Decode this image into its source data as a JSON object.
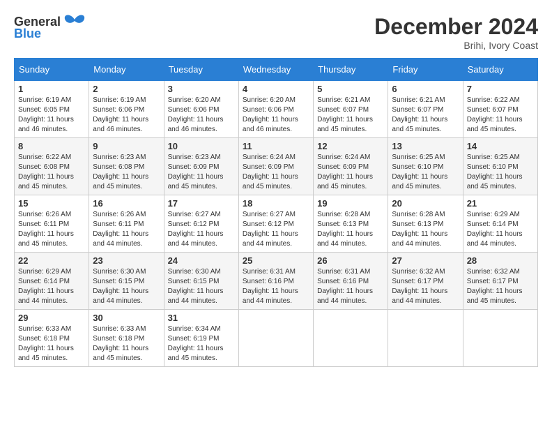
{
  "header": {
    "logo_general": "General",
    "logo_blue": "Blue",
    "month_title": "December 2024",
    "location": "Brihi, Ivory Coast"
  },
  "days_of_week": [
    "Sunday",
    "Monday",
    "Tuesday",
    "Wednesday",
    "Thursday",
    "Friday",
    "Saturday"
  ],
  "weeks": [
    [
      {
        "day": "1",
        "sunrise": "6:19 AM",
        "sunset": "6:05 PM",
        "daylight": "11 hours and 46 minutes."
      },
      {
        "day": "2",
        "sunrise": "6:19 AM",
        "sunset": "6:06 PM",
        "daylight": "11 hours and 46 minutes."
      },
      {
        "day": "3",
        "sunrise": "6:20 AM",
        "sunset": "6:06 PM",
        "daylight": "11 hours and 46 minutes."
      },
      {
        "day": "4",
        "sunrise": "6:20 AM",
        "sunset": "6:06 PM",
        "daylight": "11 hours and 46 minutes."
      },
      {
        "day": "5",
        "sunrise": "6:21 AM",
        "sunset": "6:07 PM",
        "daylight": "11 hours and 45 minutes."
      },
      {
        "day": "6",
        "sunrise": "6:21 AM",
        "sunset": "6:07 PM",
        "daylight": "11 hours and 45 minutes."
      },
      {
        "day": "7",
        "sunrise": "6:22 AM",
        "sunset": "6:07 PM",
        "daylight": "11 hours and 45 minutes."
      }
    ],
    [
      {
        "day": "8",
        "sunrise": "6:22 AM",
        "sunset": "6:08 PM",
        "daylight": "11 hours and 45 minutes."
      },
      {
        "day": "9",
        "sunrise": "6:23 AM",
        "sunset": "6:08 PM",
        "daylight": "11 hours and 45 minutes."
      },
      {
        "day": "10",
        "sunrise": "6:23 AM",
        "sunset": "6:09 PM",
        "daylight": "11 hours and 45 minutes."
      },
      {
        "day": "11",
        "sunrise": "6:24 AM",
        "sunset": "6:09 PM",
        "daylight": "11 hours and 45 minutes."
      },
      {
        "day": "12",
        "sunrise": "6:24 AM",
        "sunset": "6:09 PM",
        "daylight": "11 hours and 45 minutes."
      },
      {
        "day": "13",
        "sunrise": "6:25 AM",
        "sunset": "6:10 PM",
        "daylight": "11 hours and 45 minutes."
      },
      {
        "day": "14",
        "sunrise": "6:25 AM",
        "sunset": "6:10 PM",
        "daylight": "11 hours and 45 minutes."
      }
    ],
    [
      {
        "day": "15",
        "sunrise": "6:26 AM",
        "sunset": "6:11 PM",
        "daylight": "11 hours and 45 minutes."
      },
      {
        "day": "16",
        "sunrise": "6:26 AM",
        "sunset": "6:11 PM",
        "daylight": "11 hours and 44 minutes."
      },
      {
        "day": "17",
        "sunrise": "6:27 AM",
        "sunset": "6:12 PM",
        "daylight": "11 hours and 44 minutes."
      },
      {
        "day": "18",
        "sunrise": "6:27 AM",
        "sunset": "6:12 PM",
        "daylight": "11 hours and 44 minutes."
      },
      {
        "day": "19",
        "sunrise": "6:28 AM",
        "sunset": "6:13 PM",
        "daylight": "11 hours and 44 minutes."
      },
      {
        "day": "20",
        "sunrise": "6:28 AM",
        "sunset": "6:13 PM",
        "daylight": "11 hours and 44 minutes."
      },
      {
        "day": "21",
        "sunrise": "6:29 AM",
        "sunset": "6:14 PM",
        "daylight": "11 hours and 44 minutes."
      }
    ],
    [
      {
        "day": "22",
        "sunrise": "6:29 AM",
        "sunset": "6:14 PM",
        "daylight": "11 hours and 44 minutes."
      },
      {
        "day": "23",
        "sunrise": "6:30 AM",
        "sunset": "6:15 PM",
        "daylight": "11 hours and 44 minutes."
      },
      {
        "day": "24",
        "sunrise": "6:30 AM",
        "sunset": "6:15 PM",
        "daylight": "11 hours and 44 minutes."
      },
      {
        "day": "25",
        "sunrise": "6:31 AM",
        "sunset": "6:16 PM",
        "daylight": "11 hours and 44 minutes."
      },
      {
        "day": "26",
        "sunrise": "6:31 AM",
        "sunset": "6:16 PM",
        "daylight": "11 hours and 44 minutes."
      },
      {
        "day": "27",
        "sunrise": "6:32 AM",
        "sunset": "6:17 PM",
        "daylight": "11 hours and 44 minutes."
      },
      {
        "day": "28",
        "sunrise": "6:32 AM",
        "sunset": "6:17 PM",
        "daylight": "11 hours and 45 minutes."
      }
    ],
    [
      {
        "day": "29",
        "sunrise": "6:33 AM",
        "sunset": "6:18 PM",
        "daylight": "11 hours and 45 minutes."
      },
      {
        "day": "30",
        "sunrise": "6:33 AM",
        "sunset": "6:18 PM",
        "daylight": "11 hours and 45 minutes."
      },
      {
        "day": "31",
        "sunrise": "6:34 AM",
        "sunset": "6:19 PM",
        "daylight": "11 hours and 45 minutes."
      },
      null,
      null,
      null,
      null
    ]
  ]
}
